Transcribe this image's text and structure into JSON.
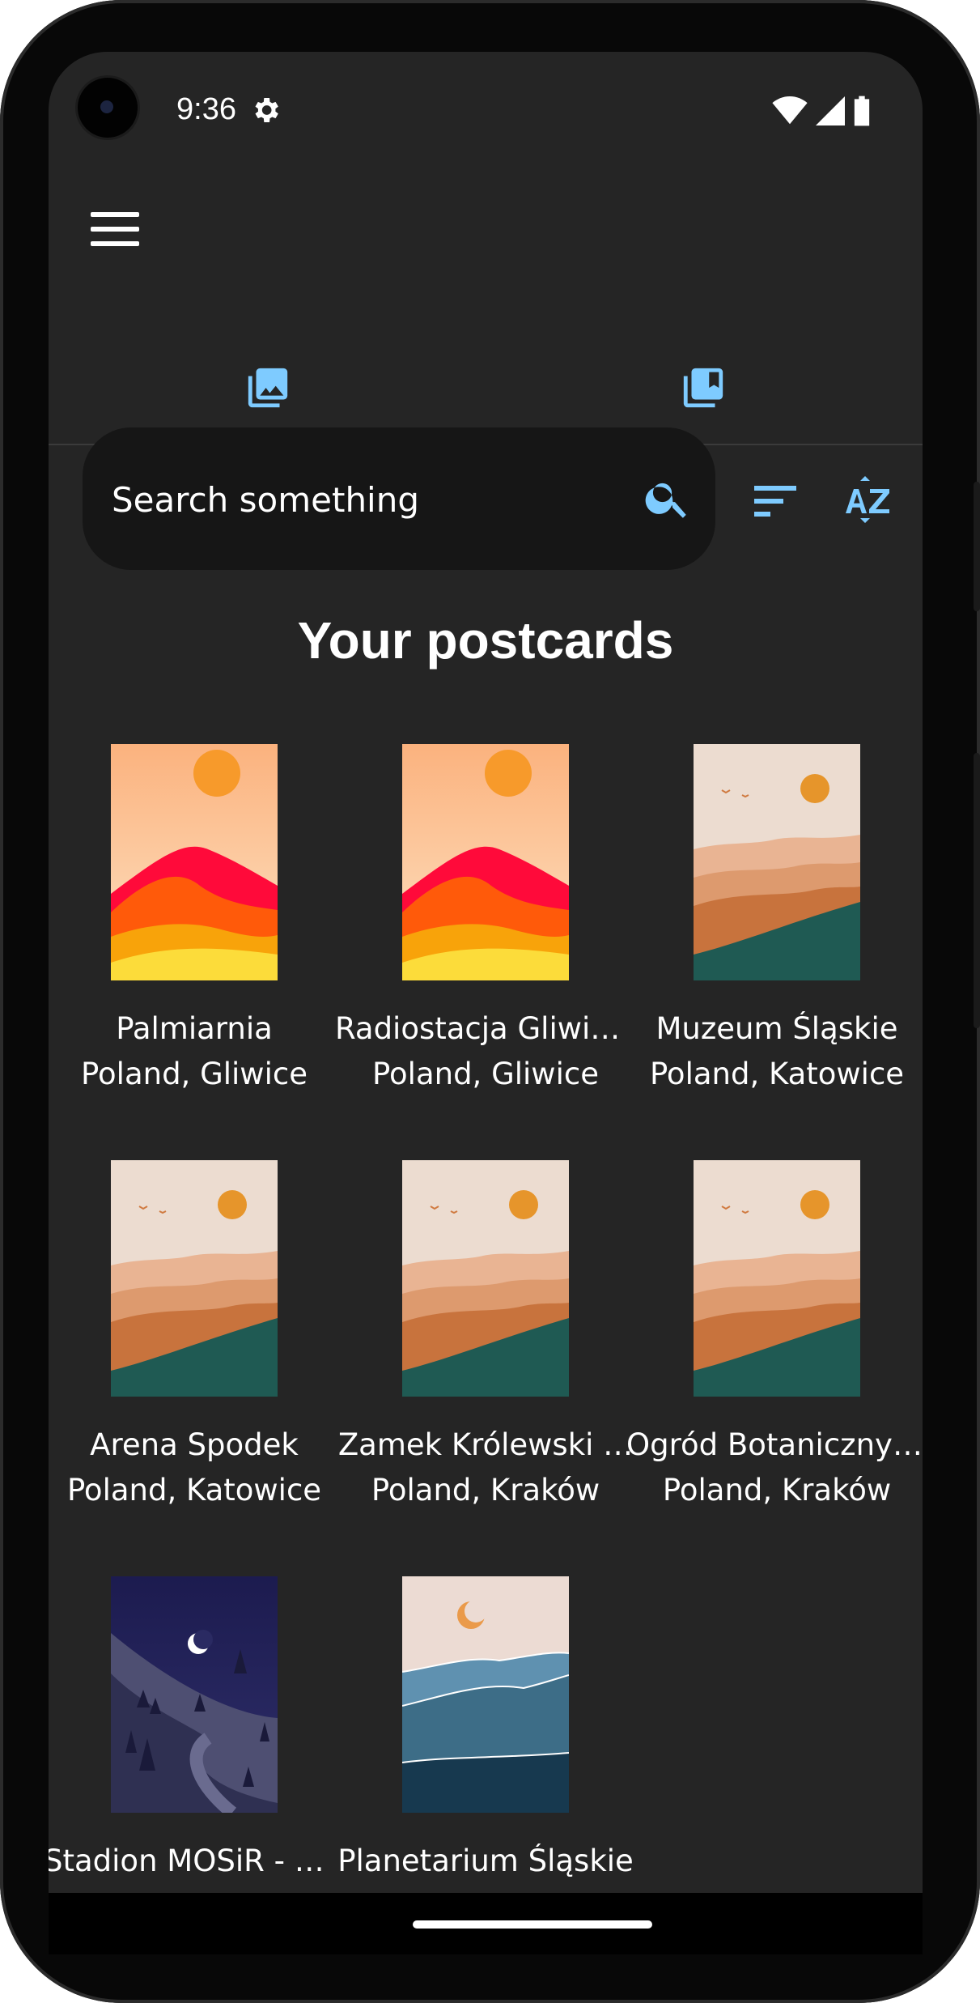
{
  "status_bar": {
    "time": "9:36"
  },
  "search": {
    "placeholder": "Search something"
  },
  "page_title": "Your postcards",
  "colors": {
    "accent": "#7ecbff",
    "background": "#252525",
    "search_bg": "#161616"
  },
  "icons": {
    "menu": "menu-icon",
    "tab_gallery": "photo-library-icon",
    "tab_collection": "bookmark-library-icon",
    "search": "search-icon",
    "sort": "sort-icon",
    "sort_alpha": "sort-by-alpha-icon"
  },
  "postcards": [
    {
      "name": "Palmiarnia",
      "location": "Poland, Gliwice",
      "image": "sunset"
    },
    {
      "name": "Radiostacja Gliwic…",
      "location": "Poland, Gliwice",
      "image": "sunset"
    },
    {
      "name": "Muzeum Śląskie",
      "location": "Poland, Katowice",
      "image": "hills"
    },
    {
      "name": "Arena Spodek",
      "location": "Poland, Katowice",
      "image": "hills"
    },
    {
      "name": "Zamek Królewski …",
      "location": "Poland, Kraków",
      "image": "hills"
    },
    {
      "name": "Ogród Botaniczny …",
      "location": "Poland, Kraków",
      "image": "hills"
    },
    {
      "name": "Stadion MOSiR - Ż…",
      "location": "",
      "image": "night"
    },
    {
      "name": "Planetarium Śląskie",
      "location": "",
      "image": "sea"
    }
  ]
}
